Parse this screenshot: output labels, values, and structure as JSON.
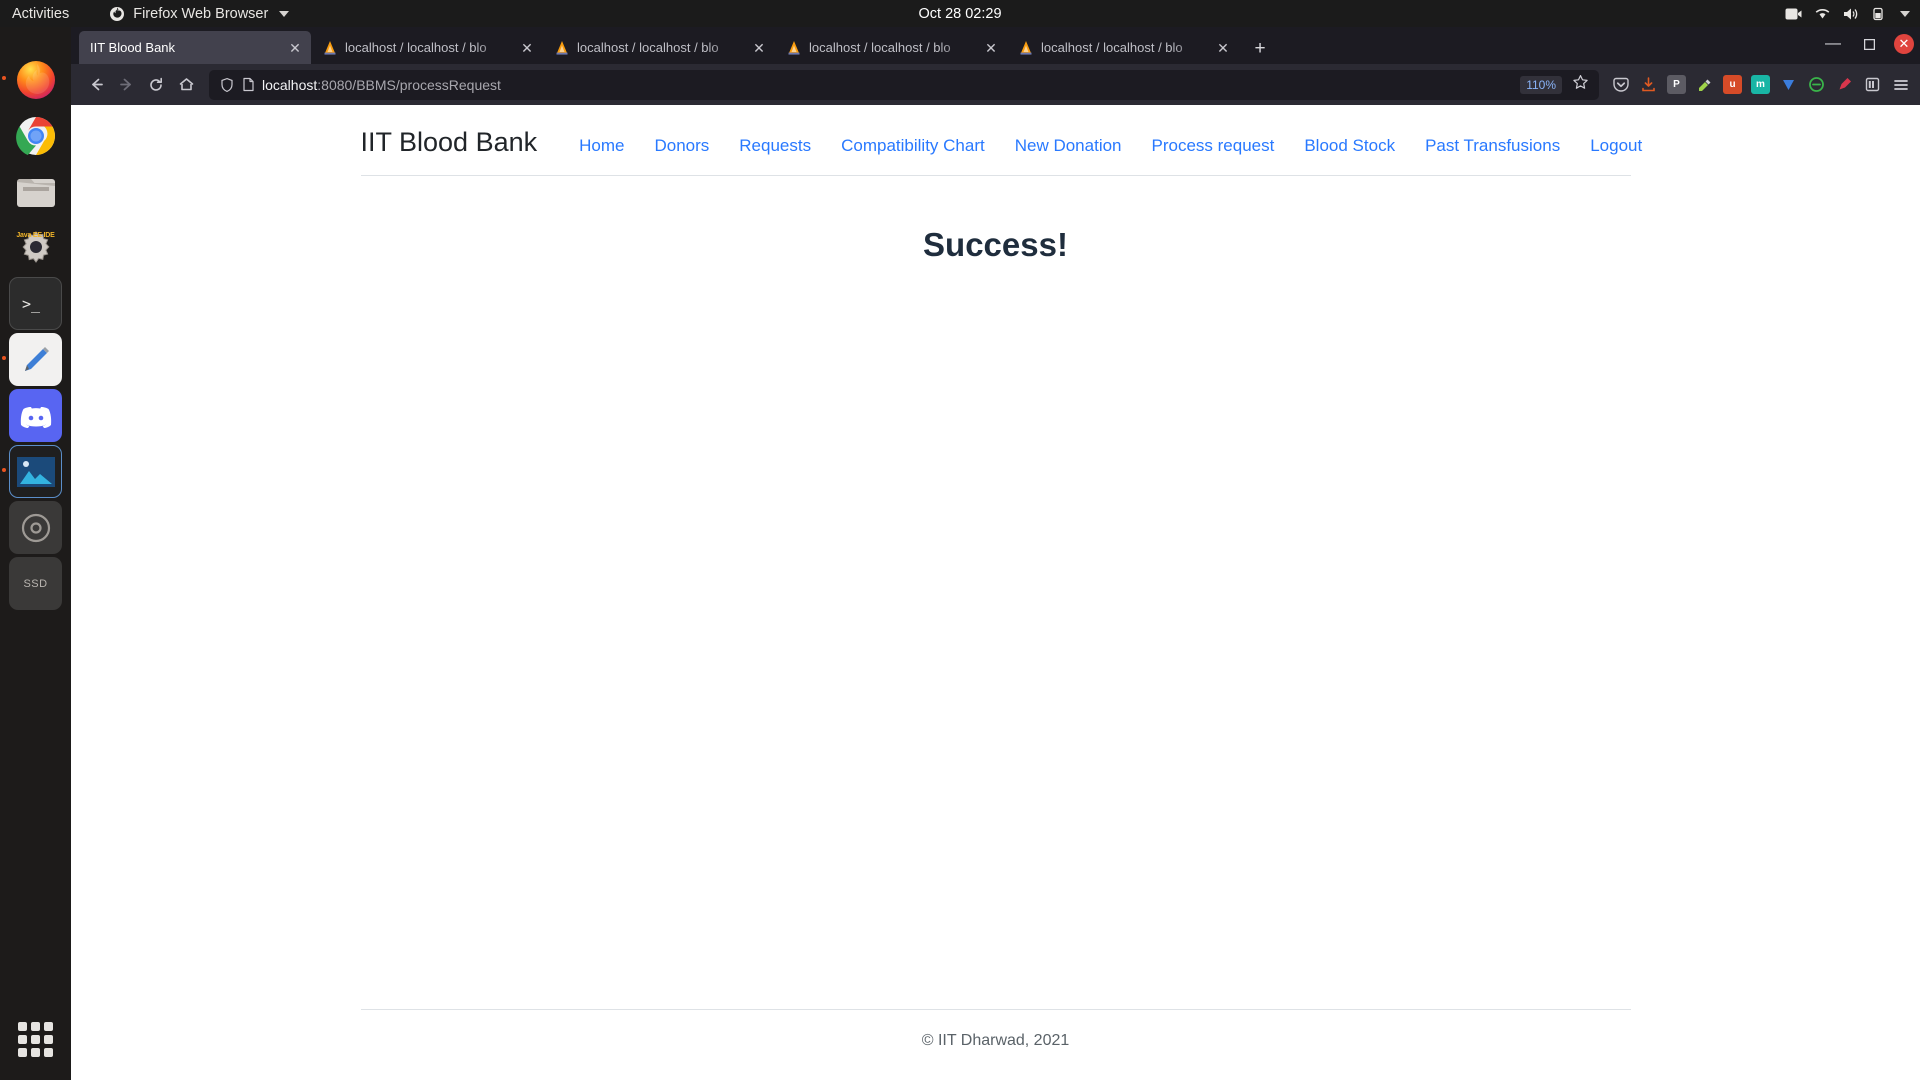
{
  "desktop": {
    "activities_label": "Activities",
    "app_menu_label": "Firefox Web Browser",
    "clock": "Oct 28  02:29",
    "tray_icons": [
      "screencast-icon",
      "wifi-icon",
      "volume-icon",
      "battery-icon",
      "power-caret-icon"
    ]
  },
  "dock": {
    "items": [
      {
        "name": "firefox",
        "label": "Firefox",
        "running": true
      },
      {
        "name": "chrome",
        "label": "Google Chrome",
        "running": false
      },
      {
        "name": "files",
        "label": "Files",
        "running": false
      },
      {
        "name": "java-ee-ide",
        "label": "Java EE IDE",
        "running": false
      },
      {
        "name": "terminal",
        "label": "Terminal",
        "running": false
      },
      {
        "name": "text-editor",
        "label": "Text Editor",
        "running": true
      },
      {
        "name": "discord",
        "label": "Discord",
        "running": false
      },
      {
        "name": "image-viewer",
        "label": "Image Viewer",
        "running": true
      },
      {
        "name": "disc-drive",
        "label": "CD Drive",
        "running": false
      },
      {
        "name": "ssd-volume",
        "label": "SSD",
        "running": false
      }
    ],
    "ssd_label": "SSD",
    "ide_label": "Java EE IDE",
    "show_apps_label": "Show Applications"
  },
  "browser": {
    "tabs": [
      {
        "title": "IIT Blood Bank",
        "active": true,
        "favicon": "none"
      },
      {
        "title": "localhost / localhost / blo",
        "active": false,
        "favicon": "phpmyadmin-icon"
      },
      {
        "title": "localhost / localhost / blo",
        "active": false,
        "favicon": "phpmyadmin-icon"
      },
      {
        "title": "localhost / localhost / blo",
        "active": false,
        "favicon": "phpmyadmin-icon"
      },
      {
        "title": "localhost / localhost / blo",
        "active": false,
        "favicon": "phpmyadmin-icon"
      }
    ],
    "new_tab_label": "+",
    "window_controls": {
      "minimize": "—",
      "maximize": "❐",
      "close": "✕"
    },
    "nav": {
      "back_label": "←",
      "forward_label": "→",
      "reload_label": "↻",
      "home_label": "⌂"
    },
    "url": {
      "scheme_host": "localhost",
      "path": ":8080/BBMS/processRequest"
    },
    "zoom_level": "110%",
    "bookmark_label": "☆",
    "menu_label": "☰",
    "extensions": [
      {
        "name": "pocket-icon",
        "glyph": "",
        "color": "#2b2a33"
      },
      {
        "name": "downloads-icon",
        "glyph": "",
        "color": "#2b2a33"
      },
      {
        "name": "p-extension-icon",
        "glyph": "P",
        "color": "#4b4a52"
      },
      {
        "name": "highlighter-extension-icon",
        "glyph": "",
        "color": "#2b2a33"
      },
      {
        "name": "u-extension-icon",
        "glyph": "u",
        "color": "#d64b28"
      },
      {
        "name": "m-extension-icon",
        "glyph": "m",
        "color": "#19b5a5"
      },
      {
        "name": "v-extension-icon",
        "glyph": "▼",
        "color": "#3b7ddd"
      },
      {
        "name": "e-extension-icon",
        "glyph": "є",
        "color": "#3ab54a"
      },
      {
        "name": "pen-extension-icon",
        "glyph": "╱",
        "color": "#d9364c"
      },
      {
        "name": "library-icon",
        "glyph": "",
        "color": "#2b2a33"
      },
      {
        "name": "hamburger-menu-icon",
        "glyph": "☰",
        "color": "#2b2a33"
      }
    ]
  },
  "site": {
    "brand": "IIT Blood Bank",
    "nav_links": [
      "Home",
      "Donors",
      "Requests",
      "Compatibility Chart",
      "New Donation",
      "Process request",
      "Blood Stock",
      "Past Transfusions",
      "Logout"
    ],
    "headline": "Success!",
    "footer": "© IIT Dharwad, 2021",
    "link_color": "#2979ff"
  }
}
